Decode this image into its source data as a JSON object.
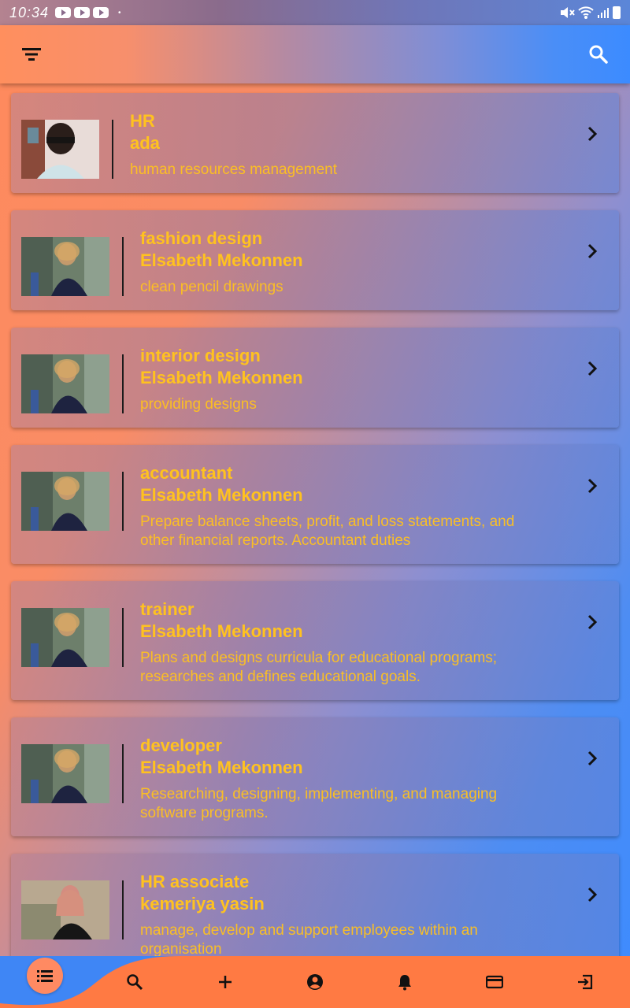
{
  "status_bar": {
    "time": "10:34",
    "dot": "•"
  },
  "app_bar": {
    "filter_icon": "filter-list-icon",
    "search_icon": "search-icon"
  },
  "colors": {
    "accent_text": "#ffc21f",
    "nav_bg": "#ff7a43",
    "nav_curve": "#3f86f5"
  },
  "cards": [
    {
      "title": "HR",
      "name": "ada",
      "description": "human resources management",
      "photo": "portrait-ada"
    },
    {
      "title": "fashion design",
      "name": "Elsabeth Mekonnen",
      "description": "clean pencil drawings",
      "photo": "portrait-elsabeth"
    },
    {
      "title": "interior design",
      "name": "Elsabeth Mekonnen",
      "description": "providing designs",
      "photo": "portrait-elsabeth"
    },
    {
      "title": "accountant",
      "name": "Elsabeth Mekonnen",
      "description": "Prepare balance sheets, profit, and loss statements, and other financial reports. Accountant duties",
      "photo": "portrait-elsabeth"
    },
    {
      "title": "trainer",
      "name": "Elsabeth Mekonnen",
      "description": "Plans and designs curricula for educational programs; researches and defines educational goals.",
      "photo": "portrait-elsabeth"
    },
    {
      "title": "developer",
      "name": "Elsabeth Mekonnen",
      "description": "Researching, designing, implementing, and managing software programs.",
      "photo": "portrait-elsabeth"
    },
    {
      "title": "HR associate",
      "name": "kemeriya yasin",
      "description": "manage, develop and support employees within an organisation",
      "photo": "portrait-kemeriya"
    }
  ],
  "bottom_nav": {
    "items": [
      "list-icon",
      "search-icon",
      "add-icon",
      "account-icon",
      "bell-icon",
      "card-icon",
      "logout-icon"
    ]
  }
}
